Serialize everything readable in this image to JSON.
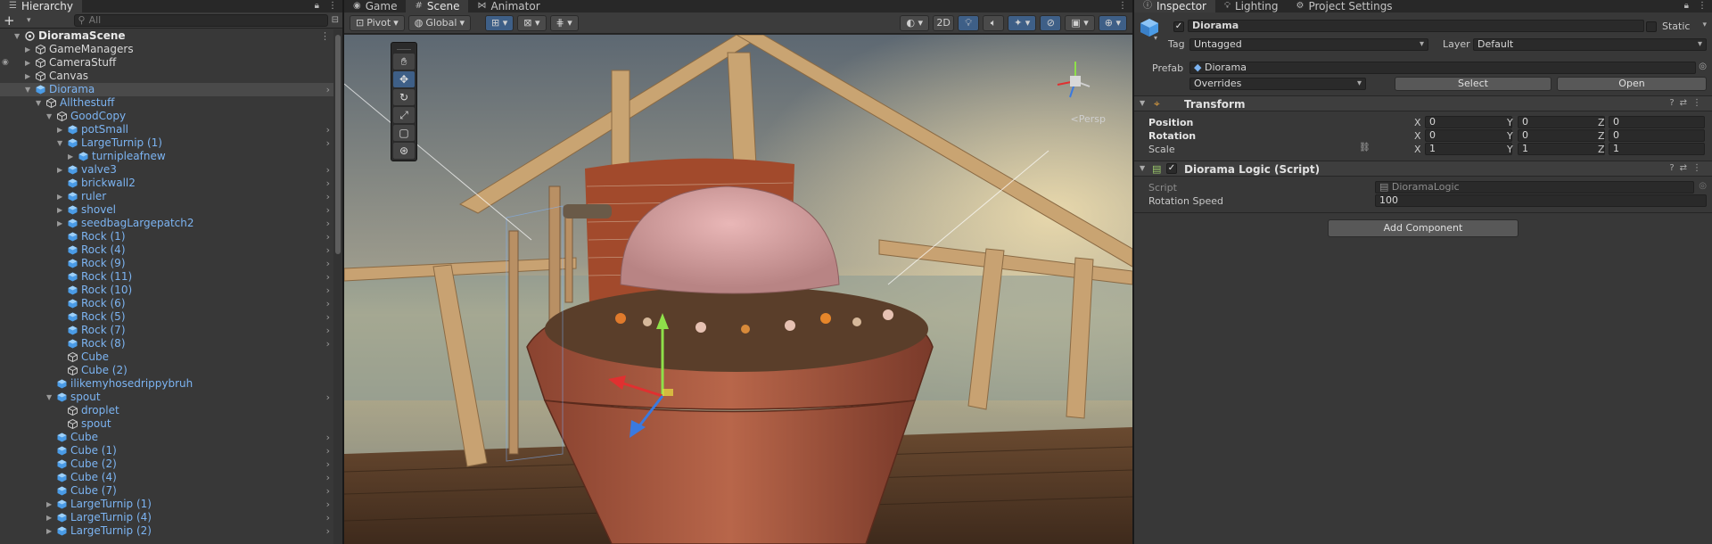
{
  "hierarchy": {
    "tab_label": "Hierarchy",
    "search_placeholder": "All",
    "add_label": "+",
    "rows": [
      {
        "label": "DioramaScene",
        "depth": 0,
        "kind": "scene",
        "expand": "open",
        "color": "white",
        "chev": false
      },
      {
        "label": "GameManagers",
        "depth": 1,
        "kind": "obj",
        "expand": "closed",
        "color": "white",
        "chev": false
      },
      {
        "label": "CameraStuff",
        "depth": 1,
        "kind": "obj",
        "expand": "closed",
        "color": "white",
        "chev": false,
        "vis": true
      },
      {
        "label": "Canvas",
        "depth": 1,
        "kind": "obj",
        "expand": "closed",
        "color": "white",
        "chev": false
      },
      {
        "label": "Diorama",
        "depth": 1,
        "kind": "prefab",
        "expand": "open",
        "color": "blue",
        "chev": true,
        "selected": true
      },
      {
        "label": "Allthestuff",
        "depth": 2,
        "kind": "obj",
        "expand": "open",
        "color": "blue",
        "chev": false
      },
      {
        "label": "GoodCopy",
        "depth": 3,
        "kind": "obj",
        "expand": "open",
        "color": "blue",
        "chev": false
      },
      {
        "label": "potSmall",
        "depth": 4,
        "kind": "prefab",
        "expand": "closed",
        "color": "blue",
        "chev": true
      },
      {
        "label": "LargeTurnip (1)",
        "depth": 4,
        "kind": "prefab",
        "expand": "open",
        "color": "blue",
        "chev": true
      },
      {
        "label": "turnipleafnew",
        "depth": 5,
        "kind": "prefab",
        "expand": "closed",
        "color": "blue",
        "chev": false
      },
      {
        "label": "valve3",
        "depth": 4,
        "kind": "prefab",
        "expand": "closed",
        "color": "blue",
        "chev": true
      },
      {
        "label": "brickwall2",
        "depth": 4,
        "kind": "prefab",
        "expand": "none",
        "color": "blue",
        "chev": true
      },
      {
        "label": "ruler",
        "depth": 4,
        "kind": "prefab",
        "expand": "closed",
        "color": "blue",
        "chev": true
      },
      {
        "label": "shovel",
        "depth": 4,
        "kind": "prefab",
        "expand": "closed",
        "color": "blue",
        "chev": true
      },
      {
        "label": "seedbagLargepatch2",
        "depth": 4,
        "kind": "prefab",
        "expand": "closed",
        "color": "blue",
        "chev": true
      },
      {
        "label": "Rock (1)",
        "depth": 4,
        "kind": "prefab",
        "expand": "none",
        "color": "blue",
        "chev": true
      },
      {
        "label": "Rock (4)",
        "depth": 4,
        "kind": "prefab",
        "expand": "none",
        "color": "blue",
        "chev": true
      },
      {
        "label": "Rock (9)",
        "depth": 4,
        "kind": "prefab",
        "expand": "none",
        "color": "blue",
        "chev": true
      },
      {
        "label": "Rock (11)",
        "depth": 4,
        "kind": "prefab",
        "expand": "none",
        "color": "blue",
        "chev": true
      },
      {
        "label": "Rock (10)",
        "depth": 4,
        "kind": "prefab",
        "expand": "none",
        "color": "blue",
        "chev": true
      },
      {
        "label": "Rock (6)",
        "depth": 4,
        "kind": "prefab",
        "expand": "none",
        "color": "blue",
        "chev": true
      },
      {
        "label": "Rock (5)",
        "depth": 4,
        "kind": "prefab",
        "expand": "none",
        "color": "blue",
        "chev": true
      },
      {
        "label": "Rock (7)",
        "depth": 4,
        "kind": "prefab",
        "expand": "none",
        "color": "blue",
        "chev": true
      },
      {
        "label": "Rock (8)",
        "depth": 4,
        "kind": "prefab",
        "expand": "none",
        "color": "blue",
        "chev": true
      },
      {
        "label": "Cube",
        "depth": 4,
        "kind": "obj",
        "expand": "none",
        "color": "blue",
        "chev": false
      },
      {
        "label": "Cube (2)",
        "depth": 4,
        "kind": "obj",
        "expand": "none",
        "color": "blue",
        "chev": false
      },
      {
        "label": "ilikemyhosedrippybruh",
        "depth": 3,
        "kind": "prefab",
        "expand": "none",
        "color": "blue",
        "chev": false
      },
      {
        "label": "spout",
        "depth": 3,
        "kind": "prefab",
        "expand": "open",
        "color": "blue",
        "chev": true
      },
      {
        "label": "droplet",
        "depth": 4,
        "kind": "obj",
        "expand": "none",
        "color": "blue",
        "chev": false
      },
      {
        "label": "spout",
        "depth": 4,
        "kind": "obj",
        "expand": "none",
        "color": "blue",
        "chev": false
      },
      {
        "label": "Cube",
        "depth": 3,
        "kind": "prefab",
        "expand": "none",
        "color": "blue",
        "chev": true
      },
      {
        "label": "Cube (1)",
        "depth": 3,
        "kind": "prefab",
        "expand": "none",
        "color": "blue",
        "chev": true
      },
      {
        "label": "Cube (2)",
        "depth": 3,
        "kind": "prefab",
        "expand": "none",
        "color": "blue",
        "chev": true
      },
      {
        "label": "Cube (4)",
        "depth": 3,
        "kind": "prefab",
        "expand": "none",
        "color": "blue",
        "chev": true
      },
      {
        "label": "Cube (7)",
        "depth": 3,
        "kind": "prefab",
        "expand": "none",
        "color": "blue",
        "chev": true
      },
      {
        "label": "LargeTurnip (1)",
        "depth": 3,
        "kind": "prefab",
        "expand": "closed",
        "color": "blue",
        "chev": true
      },
      {
        "label": "LargeTurnip (4)",
        "depth": 3,
        "kind": "prefab",
        "expand": "closed",
        "color": "blue",
        "chev": true
      },
      {
        "label": "LargeTurnip (2)",
        "depth": 3,
        "kind": "prefab",
        "expand": "closed",
        "color": "blue",
        "chev": true
      }
    ]
  },
  "scene": {
    "tabs": [
      "Game",
      "Scene",
      "Animator"
    ],
    "active_tab": "Scene",
    "pivot_label": "Pivot",
    "global_label": "Global",
    "mode_2d": "2D",
    "persp_label": "<Persp"
  },
  "inspector": {
    "tabs": [
      "Inspector",
      "Lighting",
      "Project Settings"
    ],
    "object_name": "Diorama",
    "static_label": "Static",
    "tag_label": "Tag",
    "tag_value": "Untagged",
    "layer_label": "Layer",
    "layer_value": "Default",
    "prefab_label": "Prefab",
    "prefab_value": "Diorama",
    "overrides_label": "Overrides",
    "select_label": "Select",
    "open_label": "Open",
    "transform": {
      "title": "Transform",
      "position_label": "Position",
      "rotation_label": "Rotation",
      "scale_label": "Scale",
      "x": "X",
      "y": "Y",
      "z": "Z",
      "position": [
        "0",
        "0",
        "0"
      ],
      "rotation": [
        "0",
        "0",
        "0"
      ],
      "scale": [
        "1",
        "1",
        "1"
      ]
    },
    "script_component": {
      "title": "Diorama Logic (Script)",
      "script_label": "Script",
      "script_value": "DioramaLogic",
      "speed_label": "Rotation Speed",
      "speed_value": "100"
    },
    "add_component_label": "Add Component"
  },
  "colors": {
    "accent_blue": "#3e5f87",
    "prefab_text": "#7cb4f2",
    "panel_bg": "#383838"
  }
}
